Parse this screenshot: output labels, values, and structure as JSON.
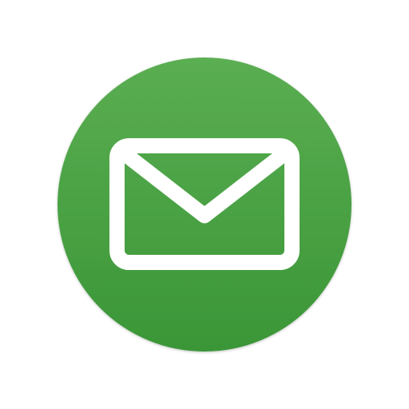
{
  "icon": {
    "name": "mail-envelope-icon",
    "colors": {
      "circle_top": "#5BAE52",
      "circle_bottom": "#3A9637",
      "envelope": "#FFFFFF",
      "background": "#FFFFFF"
    }
  }
}
